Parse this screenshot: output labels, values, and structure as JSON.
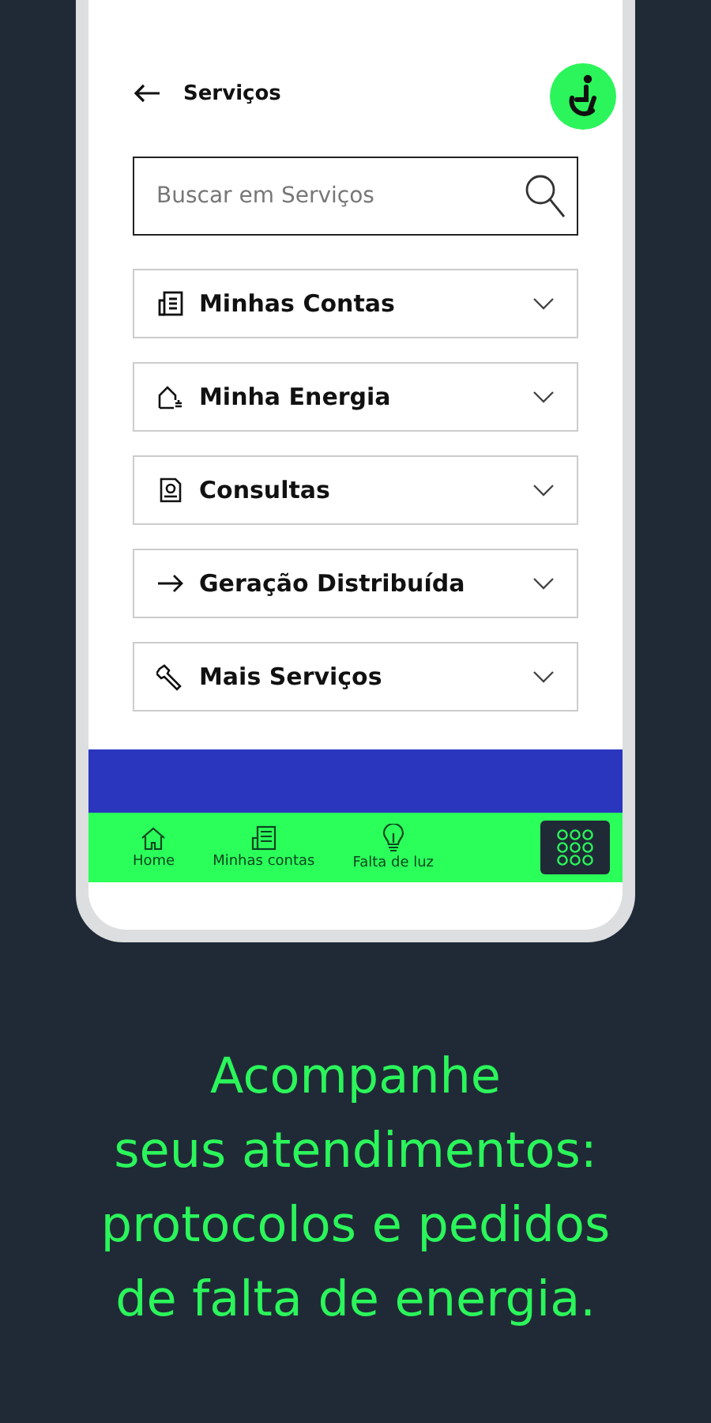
{
  "header": {
    "title": "Serviços"
  },
  "search": {
    "placeholder": "Buscar em Serviços"
  },
  "menu": [
    {
      "label": "Minhas Contas",
      "expanded": false
    },
    {
      "label": "Minha Energia",
      "expanded": false
    },
    {
      "label": "Consultas",
      "expanded": false
    },
    {
      "label": "Geração Distribuída",
      "expanded": false
    },
    {
      "label": "Mais Serviços",
      "expanded": false
    }
  ],
  "bottom_nav": {
    "items": [
      {
        "label": "Home",
        "selected": false
      },
      {
        "label": "Minhas contas",
        "selected": false
      },
      {
        "label": "Falta de luz",
        "selected": false
      }
    ],
    "menu_button": {
      "selected": true
    }
  },
  "caption": [
    "Acompanhe",
    "seus atendimentos:",
    "protocolos e pedidos",
    "de falta de energia."
  ]
}
